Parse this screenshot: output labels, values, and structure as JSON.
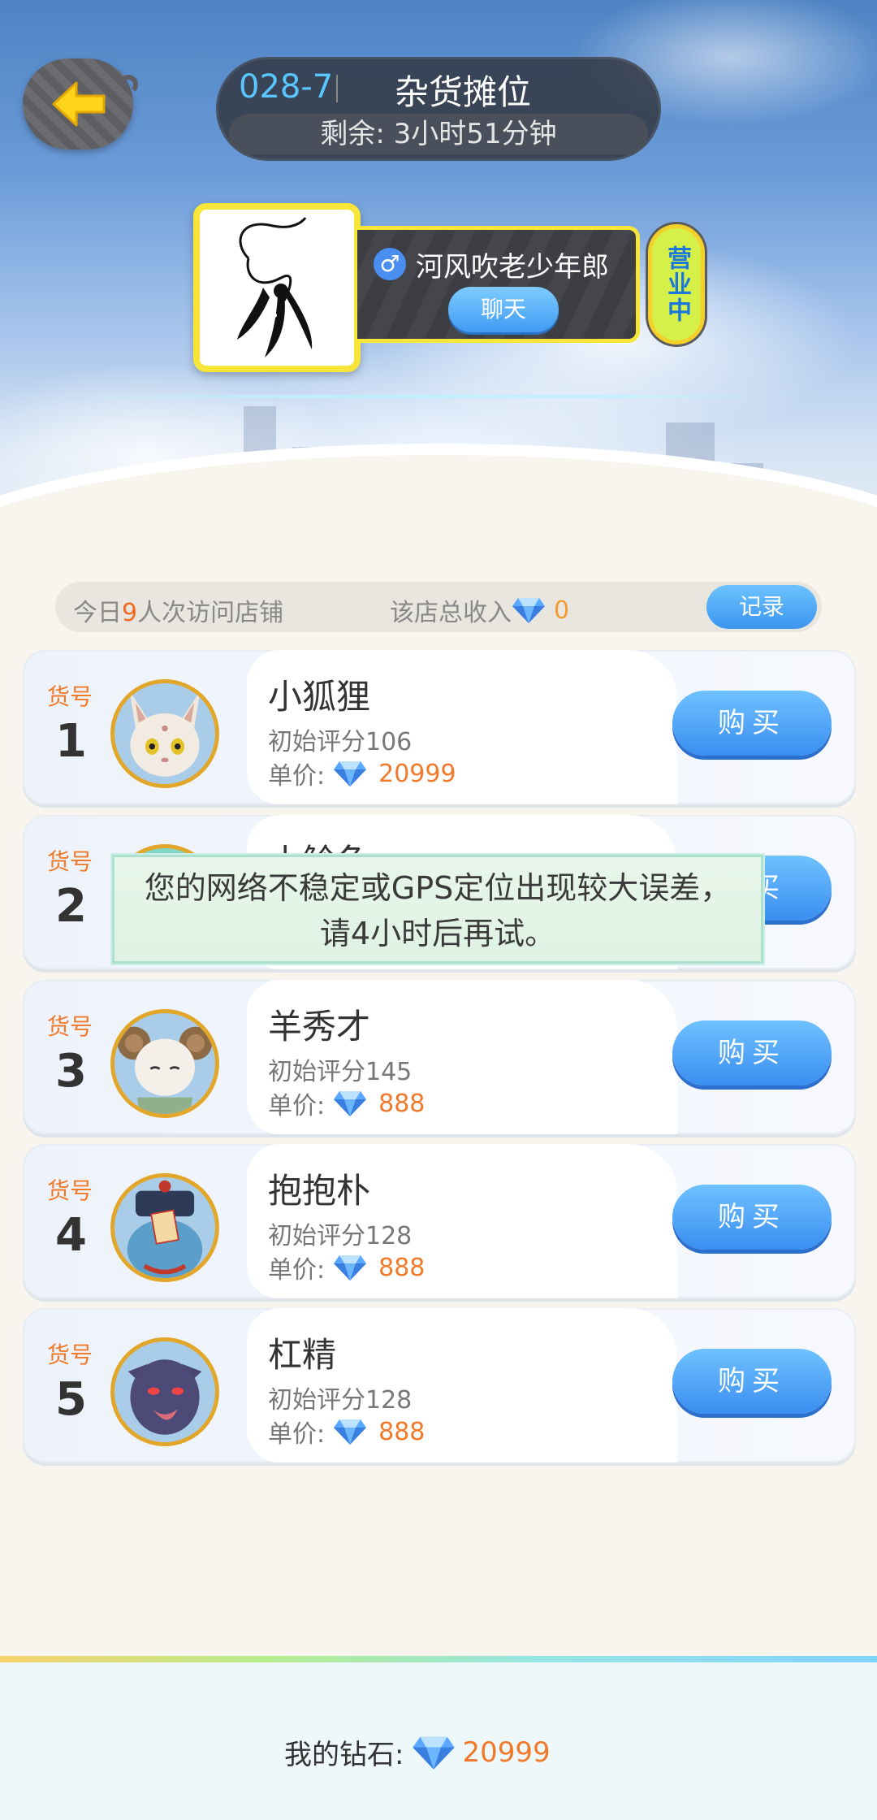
{
  "header": {
    "stall_code": "028-7",
    "stall_name": "杂货摊位",
    "remaining": "剩余: 3小时51分钟"
  },
  "seller": {
    "name": "河风吹老少年郎",
    "gender_symbol": "♂",
    "chat_label": "聊天",
    "status": "营业中"
  },
  "stats": {
    "visits_prefix": "今日",
    "visits_count": "9",
    "visits_suffix": "人次访问店铺",
    "income_label": "该店总收入",
    "income_value": "0",
    "record_label": "记录"
  },
  "items": [
    {
      "no_label": "货号",
      "no": "1",
      "name": "小狐狸",
      "score": "初始评分106",
      "price_label": "单价:",
      "price": "20999",
      "buy": "购买"
    },
    {
      "no_label": "货号",
      "no": "2",
      "name": "小鲶鱼",
      "score": "",
      "price_label": "",
      "price": "",
      "buy": "购买"
    },
    {
      "no_label": "货号",
      "no": "3",
      "name": "羊秀才",
      "score": "初始评分145",
      "price_label": "单价:",
      "price": "888",
      "buy": "购买"
    },
    {
      "no_label": "货号",
      "no": "4",
      "name": "抱抱朴",
      "score": "初始评分128",
      "price_label": "单价:",
      "price": "888",
      "buy": "购买"
    },
    {
      "no_label": "货号",
      "no": "5",
      "name": "杠精",
      "score": "初始评分128",
      "price_label": "单价:",
      "price": "888",
      "buy": "购买"
    }
  ],
  "toast": {
    "line1": "您的网络不稳定或GPS定位出现较大误差，",
    "line2": "请4小时后再试。"
  },
  "footer": {
    "label": "我的钻石:",
    "value": "20999"
  },
  "colors": {
    "accent_blue": "#3a8ef0",
    "price_orange": "#f07a2a",
    "badge_yellow": "#f7e53a"
  }
}
